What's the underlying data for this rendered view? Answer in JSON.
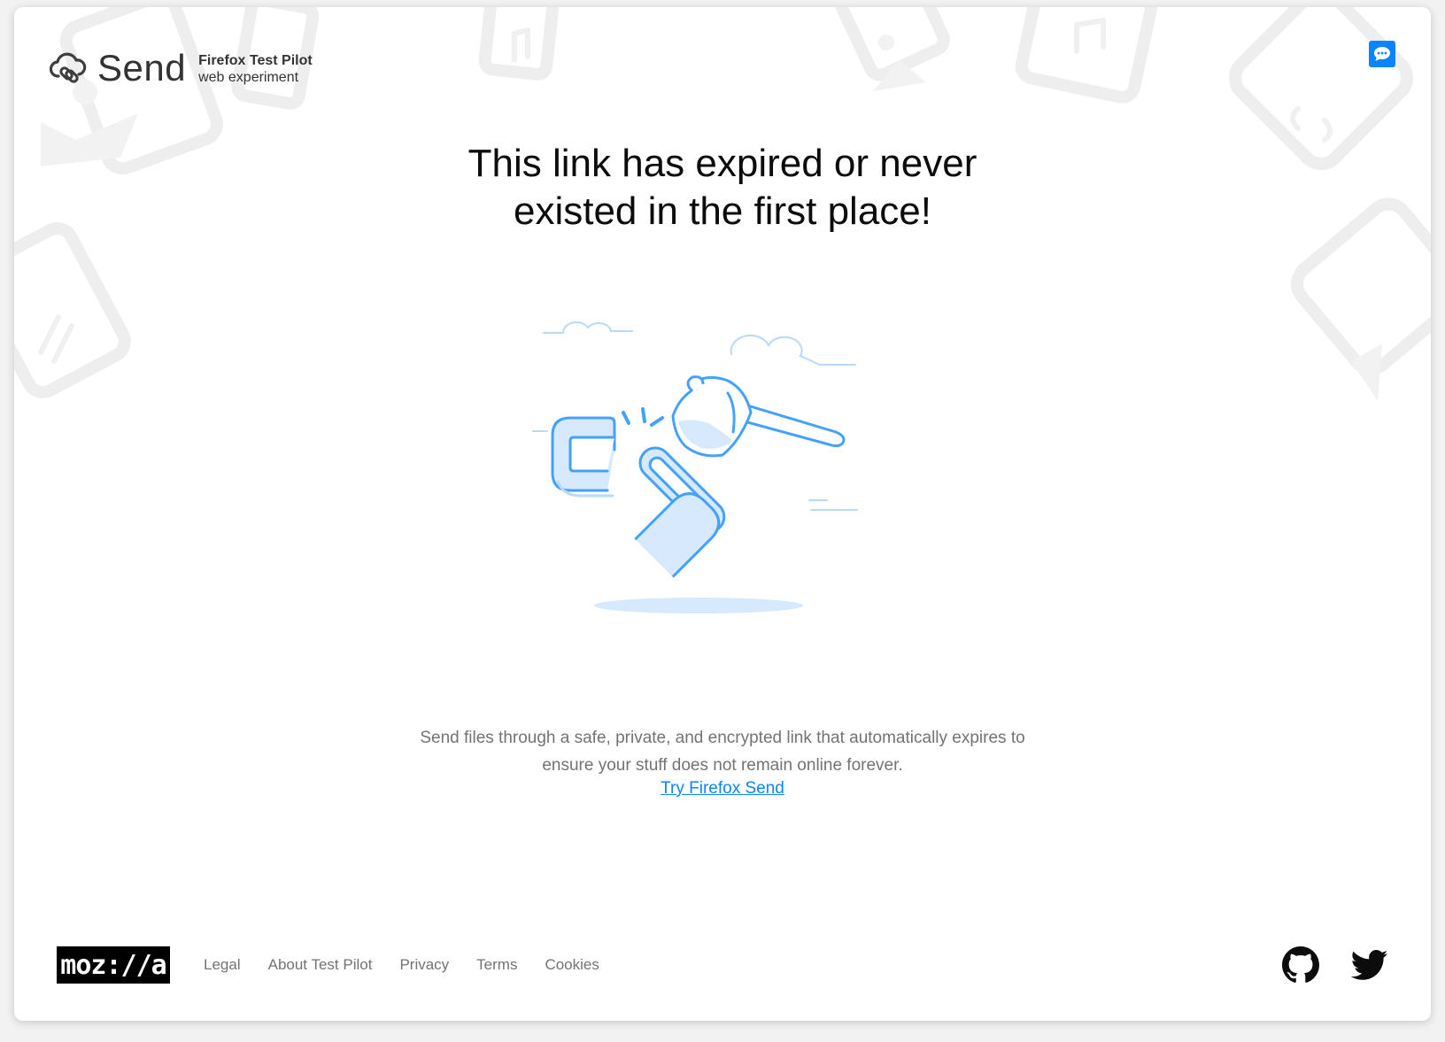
{
  "header": {
    "logo_title": "Send",
    "logo_sub_top": "Firefox Test Pilot",
    "logo_sub_bottom": "web experiment"
  },
  "headline": {
    "line1": "This link has expired or never",
    "line2": "existed in the first place!"
  },
  "description": {
    "line1": "Send files through a safe, private, and encrypted link that automatically expires to",
    "line2": "ensure your stuff does not remain online forever."
  },
  "cta": {
    "label": "Try Firefox Send"
  },
  "footer": {
    "mozilla_logo": "moz://a",
    "links": [
      "Legal",
      "About Test Pilot",
      "Privacy",
      "Terms",
      "Cookies"
    ]
  },
  "icons": {
    "feedback": "chat-bubble-icon",
    "github": "github-icon",
    "twitter": "twitter-icon",
    "logo": "send-cloud-icon"
  },
  "colors": {
    "accent": "#0a84ff",
    "illustration_stroke": "#45a1ff",
    "illustration_fill": "#d7e9fc",
    "text_muted": "#737373",
    "decor": "#efefef"
  }
}
